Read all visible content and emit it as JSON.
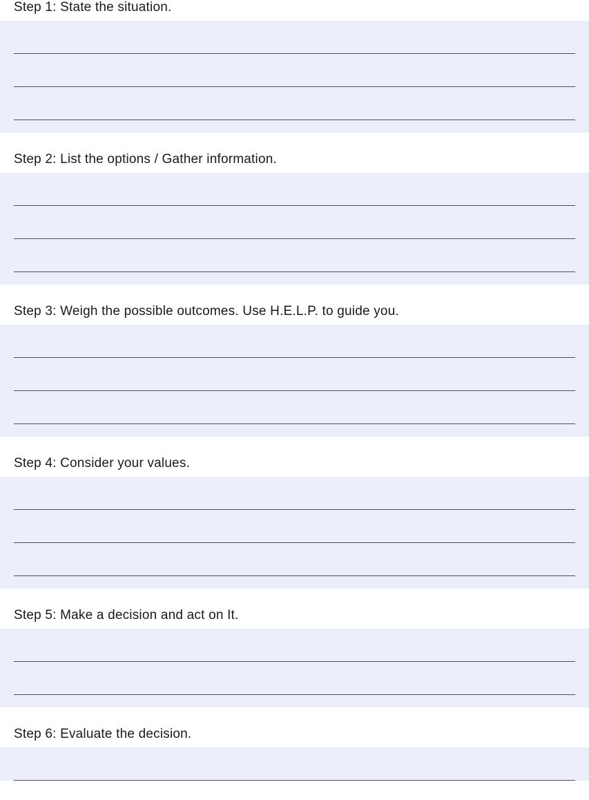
{
  "steps": [
    {
      "heading": "Step 1: State the situation.",
      "lines": 3
    },
    {
      "heading": "Step 2: List the options / Gather information.",
      "lines": 3
    },
    {
      "heading": "Step 3: Weigh the possible outcomes. Use H.E.L.P. to guide you.",
      "lines": 3
    },
    {
      "heading": "Step 4: Consider your values.",
      "lines": 3
    },
    {
      "heading": "Step 5: Make a decision and act on It.",
      "lines": 2
    },
    {
      "heading": "Step 6: Evaluate the decision.",
      "lines": 1
    }
  ]
}
